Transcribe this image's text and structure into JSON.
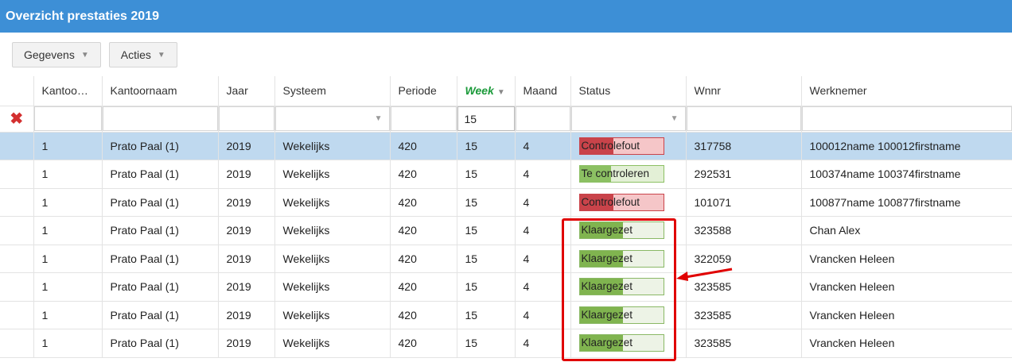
{
  "title": "Overzicht prestaties 2019",
  "toolbar": {
    "gegevens": "Gegevens",
    "acties": "Acties"
  },
  "columns": [
    "Kantoo…",
    "Kantoornaam",
    "Jaar",
    "Systeem",
    "Periode",
    "Week",
    "Maand",
    "Status",
    "Wnnr",
    "Werknemer"
  ],
  "filter": {
    "week_value": "15"
  },
  "rows": [
    {
      "kantoor": "1",
      "naam": "Prato Paal (1)",
      "jaar": "2019",
      "systeem": "Wekelijks",
      "periode": "420",
      "week": "15",
      "maand": "4",
      "status": "Controlefout",
      "status_type": "red",
      "progress": 0.4,
      "wnnr": "317758",
      "werknemer": "100012name 100012firstname"
    },
    {
      "kantoor": "1",
      "naam": "Prato Paal (1)",
      "jaar": "2019",
      "systeem": "Wekelijks",
      "periode": "420",
      "week": "15",
      "maand": "4",
      "status": "Te controleren",
      "status_type": "green",
      "progress": 0.38,
      "wnnr": "292531",
      "werknemer": "100374name 100374firstname"
    },
    {
      "kantoor": "1",
      "naam": "Prato Paal (1)",
      "jaar": "2019",
      "systeem": "Wekelijks",
      "periode": "420",
      "week": "15",
      "maand": "4",
      "status": "Controlefout",
      "status_type": "red",
      "progress": 0.4,
      "wnnr": "101071",
      "werknemer": "100877name 100877firstname"
    },
    {
      "kantoor": "1",
      "naam": "Prato Paal (1)",
      "jaar": "2019",
      "systeem": "Wekelijks",
      "periode": "420",
      "week": "15",
      "maand": "4",
      "status": "Klaargezet",
      "status_type": "klaar",
      "progress": 0.52,
      "wnnr": "323588",
      "werknemer": "Chan Alex"
    },
    {
      "kantoor": "1",
      "naam": "Prato Paal (1)",
      "jaar": "2019",
      "systeem": "Wekelijks",
      "periode": "420",
      "week": "15",
      "maand": "4",
      "status": "Klaargezet",
      "status_type": "klaar",
      "progress": 0.52,
      "wnnr": "322059",
      "werknemer": "Vrancken Heleen"
    },
    {
      "kantoor": "1",
      "naam": "Prato Paal (1)",
      "jaar": "2019",
      "systeem": "Wekelijks",
      "periode": "420",
      "week": "15",
      "maand": "4",
      "status": "Klaargezet",
      "status_type": "klaar",
      "progress": 0.52,
      "wnnr": "323585",
      "werknemer": "Vrancken Heleen"
    },
    {
      "kantoor": "1",
      "naam": "Prato Paal (1)",
      "jaar": "2019",
      "systeem": "Wekelijks",
      "periode": "420",
      "week": "15",
      "maand": "4",
      "status": "Klaargezet",
      "status_type": "klaar",
      "progress": 0.52,
      "wnnr": "323585",
      "werknemer": "Vrancken Heleen"
    },
    {
      "kantoor": "1",
      "naam": "Prato Paal (1)",
      "jaar": "2019",
      "systeem": "Wekelijks",
      "periode": "420",
      "week": "15",
      "maand": "4",
      "status": "Klaargezet",
      "status_type": "klaar",
      "progress": 0.52,
      "wnnr": "323585",
      "werknemer": "Vrancken Heleen"
    }
  ],
  "selected_row": 0,
  "colors": {
    "title_bar": "#3d8fd6",
    "selected_row": "#bfd9ef",
    "sorted_header": "#1b9a3a",
    "annotation": "#e00000"
  }
}
